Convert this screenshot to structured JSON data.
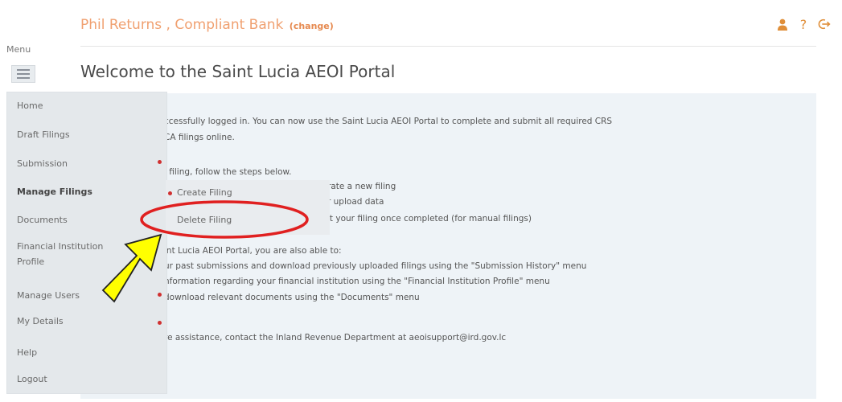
{
  "header": {
    "title": "Phil Returns , Compliant Bank",
    "change_label": "(change)",
    "icons": [
      "user-icon",
      "help-icon",
      "logout-icon"
    ],
    "help_glyph": "?"
  },
  "menu_label": "Menu",
  "page_title": "Welcome to the Saint Lucia AEOI Portal",
  "sidebar": {
    "items": [
      {
        "label": "Home"
      },
      {
        "label": "Draft Filings"
      },
      {
        "label": "Submission"
      },
      {
        "label": "Manage Filings"
      },
      {
        "label": "Documents"
      },
      {
        "label": "Financial Institution Profile"
      },
      {
        "label": "Manage Users"
      },
      {
        "label": "My Details"
      },
      {
        "label": "Help"
      },
      {
        "label": "Logout"
      }
    ],
    "submenu": [
      {
        "label": "Create Filing"
      },
      {
        "label": "Delete Filing"
      }
    ]
  },
  "content": {
    "lines": [
      "ccessfully logged in. You can now use the Saint Lucia AEOI Portal to complete and submit all required CRS",
      "CA filings online.",
      "i filing, follow the steps below.",
      "rate a new filing",
      "r upload data",
      "it your filing once completed (for manual filings)",
      "int Lucia AEOI Portal, you are also able to:",
      "ur past submissions and download previously uploaded filings using the \"Submission History\" menu",
      "nformation regarding your financial institution using the \"Financial Institution Profile\" menu",
      "download relevant documents using the \"Documents\" menu",
      "re assistance, contact the Inland Revenue Department at aeoisupport@ird.gov.lc"
    ]
  },
  "colors": {
    "accent": "#f0a070",
    "annotation_red": "#e02020",
    "arrow_yellow": "#ffff00",
    "dot_red": "#d03030"
  }
}
